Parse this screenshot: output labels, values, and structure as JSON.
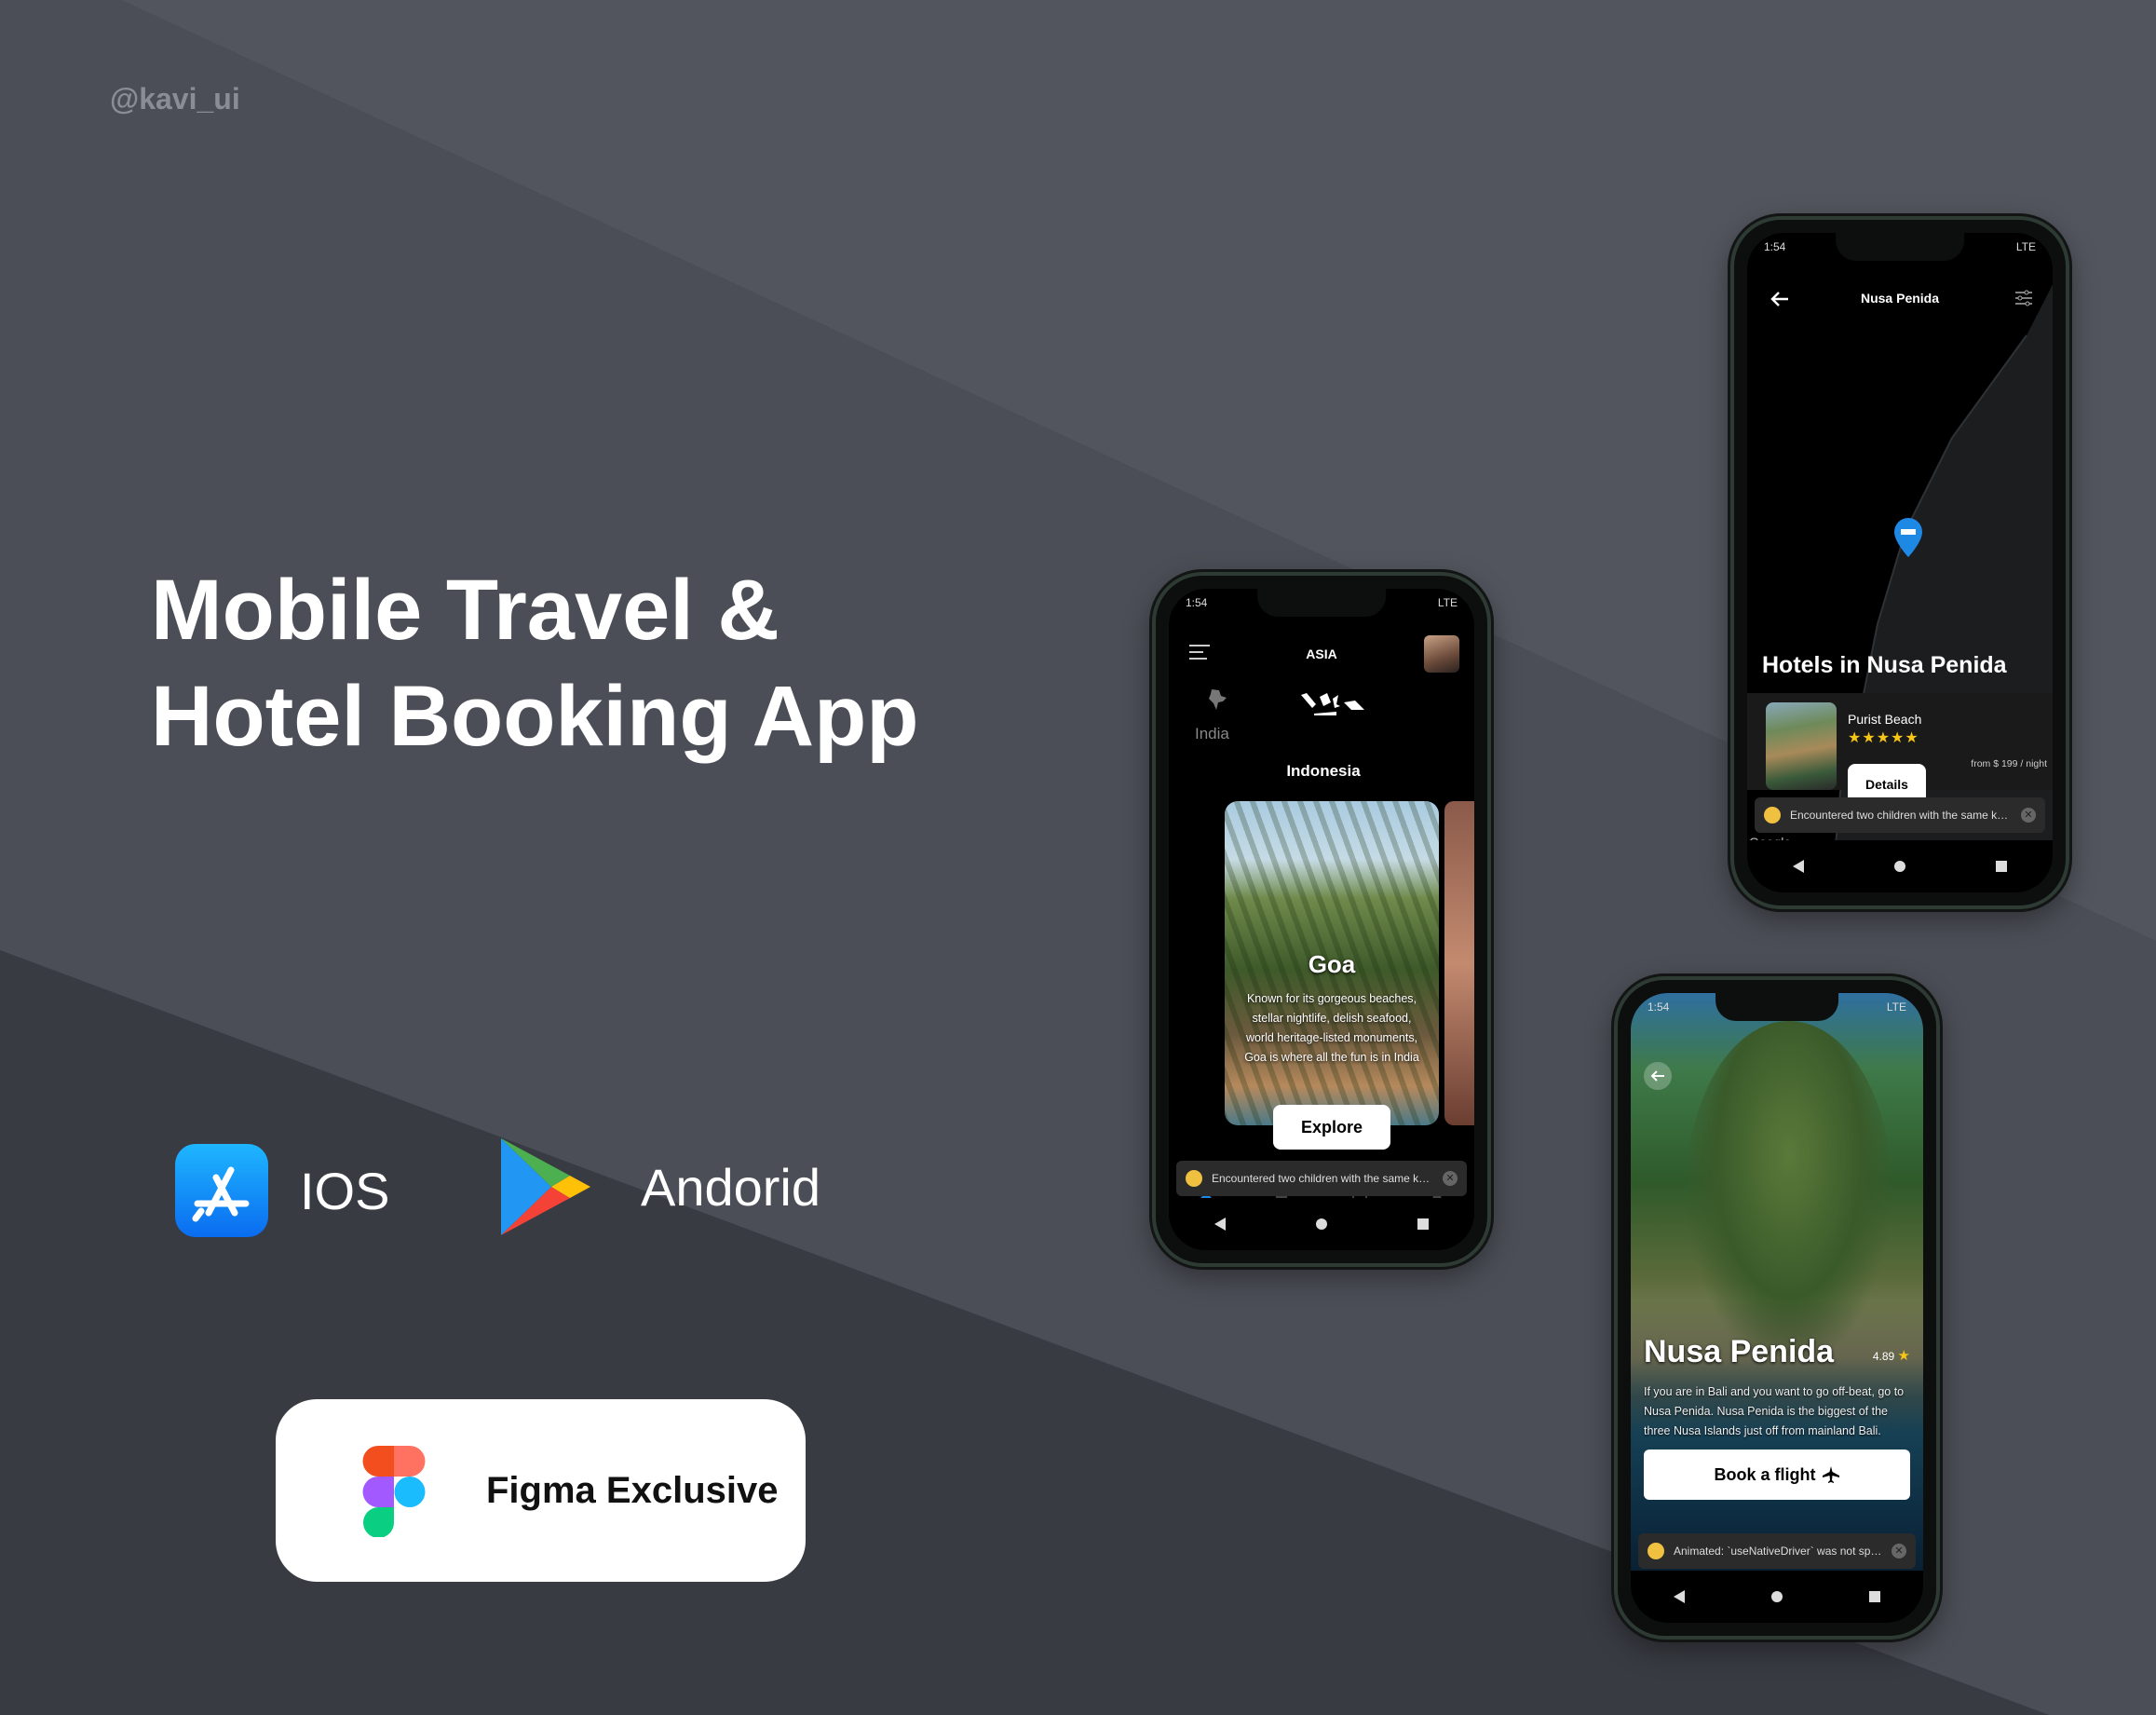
{
  "handle": "@kavi_ui",
  "headline": {
    "line1": "Mobile Travel &",
    "line2": "Hotel Booking App"
  },
  "platforms": {
    "ios": "IOS",
    "android": "Andorid"
  },
  "badge": {
    "label": "Figma Exclusive"
  },
  "colors": {
    "background": "#3b3e46",
    "band": "#4d5058",
    "accent": "#1e88e5",
    "star": "#f5c518"
  },
  "phone_explore": {
    "status_time": "1:54",
    "status_right": "LTE",
    "header_title": "ASIA",
    "countries": [
      "India",
      "Indonesia"
    ],
    "card": {
      "title": "Goa",
      "desc": "Known for its gorgeous beaches, stellar nightlife, delish seafood, world heritage-listed monuments, Goa is where all the fun is in India",
      "button": "Explore"
    },
    "toast": "Encountered two children with the same key, '..."
  },
  "phone_map": {
    "status_time": "1:54",
    "status_right": "LTE",
    "header_title": "Nusa Penida",
    "section_title": "Hotels in Nusa Penida",
    "hotel": {
      "name": "Purist Beach",
      "stars": "★★★★★",
      "button": "Details",
      "price": "from $ 199 / night"
    },
    "toast": "Encountered two children with the same key, 'f...",
    "map_attribution": "Google"
  },
  "phone_detail": {
    "status_time": "1:54",
    "status_right": "LTE",
    "title": "Nusa Penida",
    "rating": "4.89",
    "desc": "If you are in Bali and you want to go off-beat, go to Nusa Penida. Nusa Penida is the biggest of the three Nusa Islands just off from mainland Bali.",
    "button": "Book a flight",
    "toast": "Animated: `useNativeDriver` was not specified..."
  }
}
